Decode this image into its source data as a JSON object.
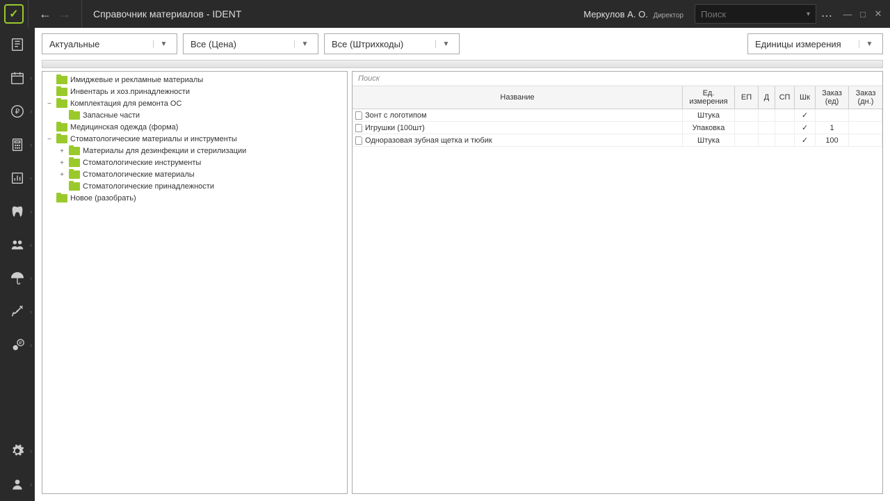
{
  "header": {
    "title": "Справочник материалов - IDENT",
    "user": "Меркулов А. О.",
    "role": "Директор",
    "search_placeholder": "Поиск"
  },
  "filters": {
    "status": "Актуальные",
    "price": "Все (Цена)",
    "barcodes": "Все (Штрихкоды)",
    "units": "Единицы измерения"
  },
  "tree": [
    {
      "label": "Имиджевые и рекламные материалы",
      "indent": 0,
      "exp": ""
    },
    {
      "label": "Инвентарь и хоз.принадлежности",
      "indent": 0,
      "exp": ""
    },
    {
      "label": "Комплектация для ремонта ОС",
      "indent": 0,
      "exp": "−"
    },
    {
      "label": "Запасные части",
      "indent": 1,
      "exp": ""
    },
    {
      "label": "Медицинская одежда (форма)",
      "indent": 0,
      "exp": ""
    },
    {
      "label": "Стоматологические материалы и инструменты",
      "indent": 0,
      "exp": "−"
    },
    {
      "label": "Материалы для дезинфекции и стерилизации",
      "indent": 1,
      "exp": "+"
    },
    {
      "label": "Стоматологические инструменты",
      "indent": 1,
      "exp": "+"
    },
    {
      "label": "Стоматологические материалы",
      "indent": 1,
      "exp": "+"
    },
    {
      "label": "Стоматологические принадлежности",
      "indent": 1,
      "exp": ""
    },
    {
      "label": "Новое (разобрать)",
      "indent": 0,
      "exp": ""
    }
  ],
  "table": {
    "search_label": "Поиск",
    "headers": {
      "name": "Название",
      "unit": "Ед. измерения",
      "ep": "ЕП",
      "d": "Д",
      "sp": "СП",
      "shk": "Шк",
      "order_ed": "Заказ (ед)",
      "order_days": "Заказ (дн.)"
    },
    "rows": [
      {
        "name": "Зонт с логотипом",
        "unit": "Штука",
        "ep": "",
        "d": "",
        "sp": "",
        "shk": "✓",
        "ord": "",
        "days": ""
      },
      {
        "name": "Игрушки (100шт)",
        "unit": "Упаковка",
        "ep": "",
        "d": "",
        "sp": "",
        "shk": "✓",
        "ord": "1",
        "days": ""
      },
      {
        "name": "Одноразовая зубная щетка и тюбик",
        "unit": "Штука",
        "ep": "",
        "d": "",
        "sp": "",
        "shk": "✓",
        "ord": "100",
        "days": ""
      }
    ]
  }
}
